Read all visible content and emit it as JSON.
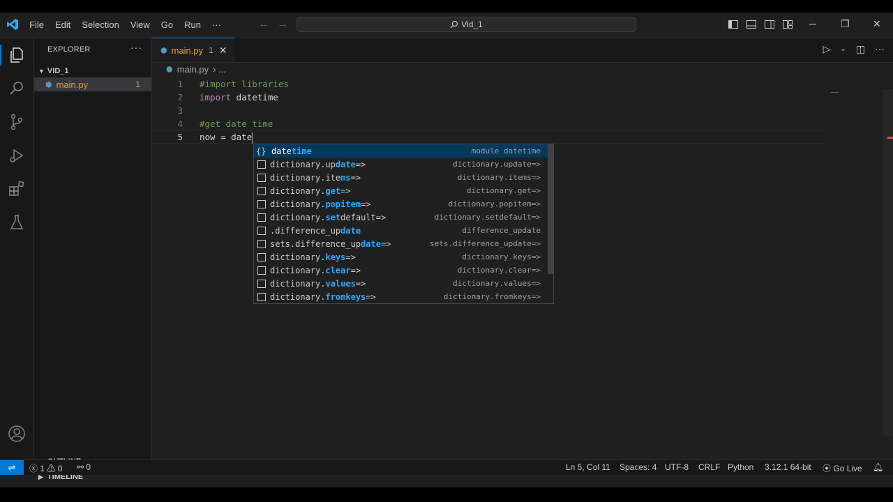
{
  "menu": [
    "File",
    "Edit",
    "Selection",
    "View",
    "Go",
    "Run",
    "···"
  ],
  "command_center": "Vid_1",
  "window_buttons": [
    "─",
    "❐",
    "✕"
  ],
  "sidebar": {
    "title": "EXPLORER",
    "more": "···",
    "folder": "VID_1",
    "file": {
      "name": "main.py",
      "badge": "1"
    },
    "outline": "OUTLINE",
    "timeline": "TIMELINE"
  },
  "tab": {
    "name": "main.py",
    "badge": "1",
    "close": "✕"
  },
  "breadcrumb": {
    "file": "main.py",
    "rest": "› ..."
  },
  "code_lines": [
    {
      "n": "1",
      "text": "#import libraries"
    },
    {
      "n": "2",
      "kw": "import",
      "text": " datetime"
    },
    {
      "n": "3",
      "text": ""
    },
    {
      "n": "4",
      "text": "#get date time"
    },
    {
      "n": "5",
      "text": "now = date"
    }
  ],
  "suggestions": [
    {
      "icon": "module",
      "label": [
        "date",
        "time",
        ""
      ],
      "detail": "module datetime"
    },
    {
      "icon": "box",
      "label": [
        "dictionary.up",
        "date",
        "=>"
      ],
      "detail": "dictionary.update=>"
    },
    {
      "icon": "box",
      "label": [
        "dictionary.ite",
        "ms",
        "=>"
      ],
      "detail": "dictionary.items=>"
    },
    {
      "icon": "box",
      "label": [
        "dictionary.",
        "get",
        "=>"
      ],
      "detail": "dictionary.get=>"
    },
    {
      "icon": "box",
      "label": [
        "dictionary.",
        "popitem",
        "=>"
      ],
      "detail": "dictionary.popitem=>"
    },
    {
      "icon": "box",
      "label": [
        "dictionary.",
        "set",
        "default=>"
      ],
      "detail": "dictionary.setdefault=>"
    },
    {
      "icon": "box",
      "label": [
        ".difference_up",
        "date",
        ""
      ],
      "detail": "difference_update"
    },
    {
      "icon": "box",
      "label": [
        "sets.difference_up",
        "date",
        "=>"
      ],
      "detail": "sets.difference_update=>"
    },
    {
      "icon": "box",
      "label": [
        "dictionary.",
        "keys",
        "=>"
      ],
      "detail": "dictionary.keys=>"
    },
    {
      "icon": "box",
      "label": [
        "dictionary.",
        "clear",
        "=>"
      ],
      "detail": "dictionary.clear=>"
    },
    {
      "icon": "box",
      "label": [
        "dictionary.",
        "values",
        "=>"
      ],
      "detail": "dictionary.values=>"
    },
    {
      "icon": "box",
      "label": [
        "dictionary.",
        "fromkeys",
        "=>"
      ],
      "detail": "dictionary.fromkeys=>"
    }
  ],
  "status": {
    "errors": "1",
    "warnings": "0",
    "ports": "0",
    "position": "Ln 5, Col 11",
    "spaces": "Spaces: 4",
    "encoding": "UTF-8",
    "eol": "CRLF",
    "language": "Python",
    "interpreter": "3.12.1 64-bit",
    "golive": "Go Live"
  },
  "colors": {
    "accent": "#0078d4",
    "warning_file": "#e2a03f",
    "match": "#2aaaff"
  }
}
